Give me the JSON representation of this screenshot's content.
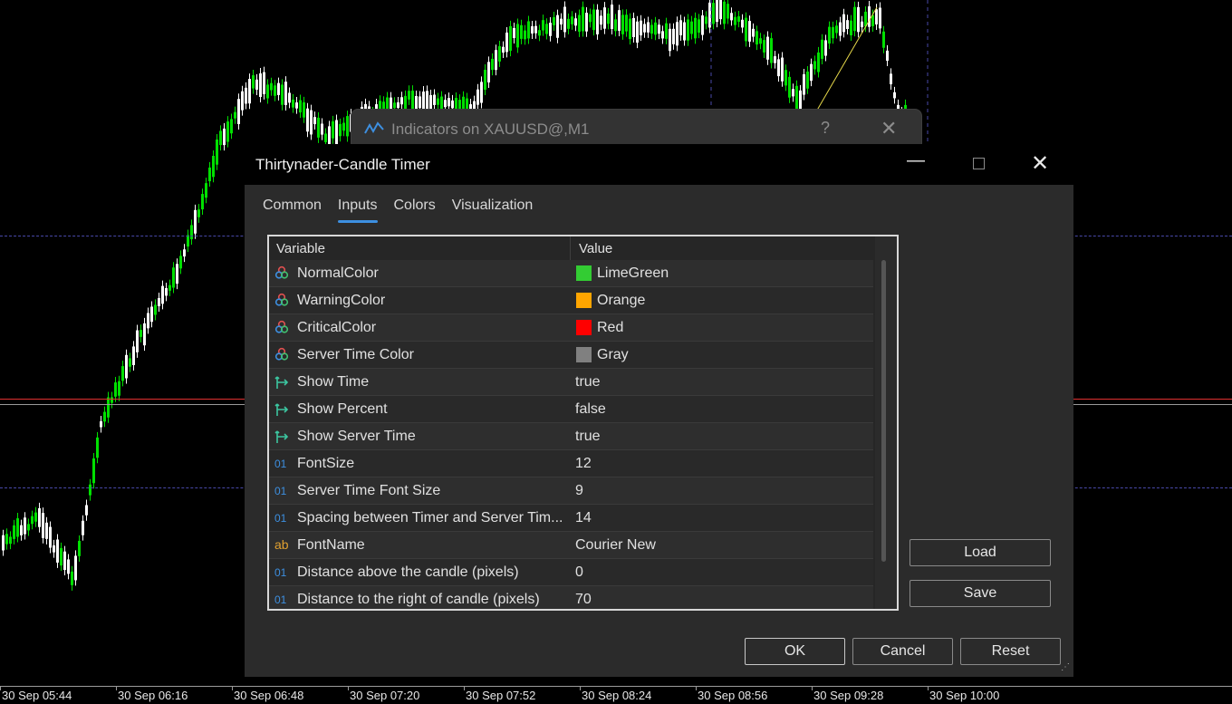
{
  "background_dialog": {
    "title": "Indicators on XAUUSD@,M1",
    "help_label": "?",
    "close_label": "✕"
  },
  "dialog": {
    "title": "Thirtynader-Candle Timer",
    "min_label": "—",
    "close_label": "✕",
    "tabs": [
      {
        "label": "Common",
        "active": false
      },
      {
        "label": "Inputs",
        "active": true
      },
      {
        "label": "Colors",
        "active": false
      },
      {
        "label": "Visualization",
        "active": false
      }
    ],
    "grid": {
      "col_variable": "Variable",
      "col_value": "Value",
      "rows": [
        {
          "icon": "color-icon",
          "name": "NormalColor",
          "value": "LimeGreen",
          "swatch": "#33cc33"
        },
        {
          "icon": "color-icon",
          "name": "WarningColor",
          "value": "Orange",
          "swatch": "#ffa500"
        },
        {
          "icon": "color-icon",
          "name": "CriticalColor",
          "value": "Red",
          "swatch": "#ff0000"
        },
        {
          "icon": "color-icon",
          "name": "Server Time Color",
          "value": "Gray",
          "swatch": "#808080"
        },
        {
          "icon": "bool-icon",
          "name": "Show Time",
          "value": "true"
        },
        {
          "icon": "bool-icon",
          "name": "Show Percent",
          "value": "false"
        },
        {
          "icon": "bool-icon",
          "name": "Show Server Time",
          "value": "true"
        },
        {
          "icon": "int-icon",
          "name": "FontSize",
          "value": "12"
        },
        {
          "icon": "int-icon",
          "name": "Server Time Font Size",
          "value": "9"
        },
        {
          "icon": "int-icon",
          "name": "Spacing between Timer and Server Tim...",
          "value": "14"
        },
        {
          "icon": "string-icon",
          "name": "FontName",
          "value": "Courier New"
        },
        {
          "icon": "int-icon",
          "name": "Distance above the candle (pixels)",
          "value": "0"
        },
        {
          "icon": "int-icon",
          "name": "Distance to the right of candle (pixels)",
          "value": "70"
        }
      ]
    },
    "buttons": {
      "load": "Load",
      "save": "Save",
      "ok": "OK",
      "cancel": "Cancel",
      "reset": "Reset"
    }
  },
  "time_axis": {
    "labels": [
      "30 Sep 05:44",
      "30 Sep 06:16",
      "30 Sep 06:48",
      "30 Sep 07:20",
      "30 Sep 07:52",
      "30 Sep 08:24",
      "30 Sep 08:56",
      "30 Sep 09:28",
      "30 Sep 10:00"
    ]
  },
  "colors": {
    "bull_candle": "#00e000",
    "bear_candle": "#ffffff",
    "price_line": "#e03030",
    "level_line": "#4848a8",
    "trend_line": "#e6d84a",
    "accent": "#3d8fe0"
  }
}
